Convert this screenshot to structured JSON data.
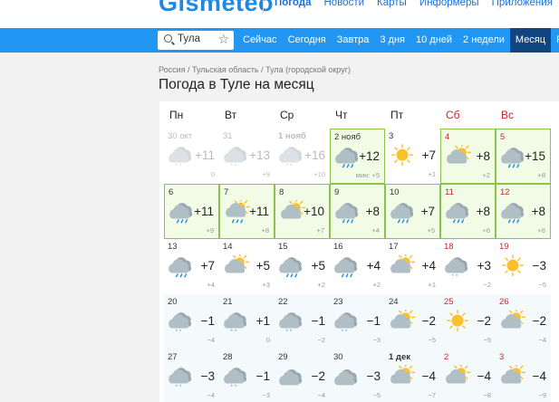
{
  "brand": {
    "logo": "Gismeteo"
  },
  "top_nav": [
    {
      "label": "Погода",
      "active": true
    },
    {
      "label": "Новости"
    },
    {
      "label": "Карты"
    },
    {
      "label": "Информеры"
    },
    {
      "label": "Приложения"
    }
  ],
  "search": {
    "city": "Тула"
  },
  "period_tabs": [
    {
      "label": "Сейчас"
    },
    {
      "label": "Сегодня"
    },
    {
      "label": "Завтра"
    },
    {
      "label": "3 дня"
    },
    {
      "label": "10 дней"
    },
    {
      "label": "2 недели"
    },
    {
      "label": "Месяц",
      "active": true
    },
    {
      "label": "Рад"
    }
  ],
  "breadcrumb": "Россия / Тульская область / Тула (городской округ)",
  "page_title": "Погода в Туле на месяц",
  "weekdays": [
    {
      "label": "Пн"
    },
    {
      "label": "Вт"
    },
    {
      "label": "Ср"
    },
    {
      "label": "Чт"
    },
    {
      "label": "Пт"
    },
    {
      "label": "Сб",
      "weekend": true
    },
    {
      "label": "Вс",
      "weekend": true
    }
  ],
  "weeks": [
    [
      {
        "date": "30 окт",
        "icon": "cloud-snow",
        "max": "+11",
        "min": "0",
        "state": "past"
      },
      {
        "date": "31",
        "icon": "cloud-snow",
        "max": "+13",
        "min": "+9",
        "state": "past"
      },
      {
        "date": "1 нояб",
        "icon": "cloud-snow",
        "max": "+16",
        "min": "+10",
        "state": "past",
        "bold": true
      },
      {
        "date": "2 нояб",
        "icon": "cloud-rain",
        "max": "+12",
        "min": "мин: +5",
        "state": "hl"
      },
      {
        "date": "3",
        "icon": "sun",
        "max": "+7",
        "min": "+1"
      },
      {
        "date": "4",
        "icon": "sun-cloud",
        "max": "+8",
        "min": "+2",
        "weekend": true,
        "state": "hl"
      },
      {
        "date": "5",
        "icon": "cloud-rain",
        "max": "+15",
        "min": "+8",
        "weekend": true,
        "state": "hl"
      }
    ],
    [
      {
        "date": "6",
        "icon": "cloud-rain",
        "max": "+11",
        "min": "+9",
        "state": "hl"
      },
      {
        "date": "7",
        "icon": "sun-cloud-rain",
        "max": "+11",
        "min": "+8",
        "state": "hl"
      },
      {
        "date": "8",
        "icon": "sun-cloud",
        "max": "+10",
        "min": "+7",
        "state": "hl"
      },
      {
        "date": "9",
        "icon": "cloud-rain",
        "max": "+8",
        "min": "+4",
        "state": "hl"
      },
      {
        "date": "10",
        "icon": "cloud-rain",
        "max": "+7",
        "min": "+5",
        "state": "hl"
      },
      {
        "date": "11",
        "icon": "cloud-rain",
        "max": "+8",
        "min": "+6",
        "weekend": true,
        "state": "hl"
      },
      {
        "date": "12",
        "icon": "cloud-rain",
        "max": "+8",
        "min": "+6",
        "weekend": true,
        "state": "hl"
      }
    ],
    [
      {
        "date": "13",
        "icon": "cloud-rain",
        "max": "+7",
        "min": "+4"
      },
      {
        "date": "14",
        "icon": "sun-cloud",
        "max": "+5",
        "min": "+3"
      },
      {
        "date": "15",
        "icon": "cloud-rain",
        "max": "+5",
        "min": "+2"
      },
      {
        "date": "16",
        "icon": "cloud-rain",
        "max": "+4",
        "min": "+2"
      },
      {
        "date": "17",
        "icon": "sun-cloud",
        "max": "+4",
        "min": "+1"
      },
      {
        "date": "18",
        "icon": "cloud-snow",
        "max": "+3",
        "min": "−2",
        "weekend": true
      },
      {
        "date": "19",
        "icon": "sun",
        "max": "−3",
        "min": "−5",
        "weekend": true
      }
    ],
    [
      {
        "date": "20",
        "icon": "cloud-snow",
        "max": "−1",
        "min": "−4",
        "state": "cool"
      },
      {
        "date": "21",
        "icon": "cloud-snow",
        "max": "+1",
        "min": "0",
        "state": "cool"
      },
      {
        "date": "22",
        "icon": "cloud-snow",
        "max": "−1",
        "min": "−2",
        "state": "cool"
      },
      {
        "date": "23",
        "icon": "cloud-snow",
        "max": "−1",
        "min": "−3",
        "state": "cool"
      },
      {
        "date": "24",
        "icon": "sun-cloud",
        "max": "−2",
        "min": "−5",
        "state": "cool"
      },
      {
        "date": "25",
        "icon": "sun",
        "max": "−2",
        "min": "−5",
        "weekend": true,
        "state": "cool"
      },
      {
        "date": "26",
        "icon": "sun-cloud",
        "max": "−2",
        "min": "−4",
        "weekend": true,
        "state": "cool"
      }
    ],
    [
      {
        "date": "27",
        "icon": "cloud-snow",
        "max": "−3",
        "min": "−4",
        "state": "cool"
      },
      {
        "date": "28",
        "icon": "cloud-snow",
        "max": "−1",
        "min": "−3",
        "state": "cool"
      },
      {
        "date": "29",
        "icon": "cloud",
        "max": "−2",
        "min": "−4",
        "state": "cool"
      },
      {
        "date": "30",
        "icon": "cloud",
        "max": "−3",
        "min": "−5",
        "state": "cool"
      },
      {
        "date": "1 дек",
        "icon": "sun-cloud",
        "max": "−4",
        "min": "−7",
        "bold": true,
        "state": "cool"
      },
      {
        "date": "2",
        "icon": "sun-cloud",
        "max": "−4",
        "min": "−8",
        "weekend": true,
        "state": "cool"
      },
      {
        "date": "3",
        "icon": "sun-cloud",
        "max": "−4",
        "min": "−9",
        "weekend": true,
        "state": "cool"
      }
    ]
  ],
  "colors": {
    "accent": "#2196f3",
    "active_tab": "#12447f",
    "weekend": "#c62828",
    "highlight_border": "#8bc34a",
    "sun": "#fbc02d",
    "cloud": "#b0bec5",
    "rain": "#1e88e5"
  }
}
